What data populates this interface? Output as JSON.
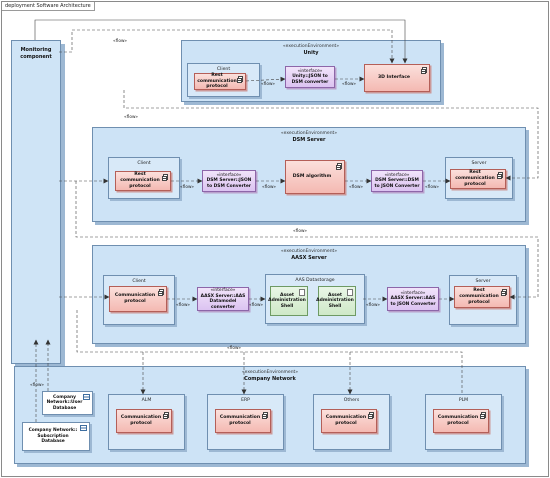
{
  "frame_title": "deployment Software Architecture",
  "monitoring": {
    "name": "Monitoring component"
  },
  "unity": {
    "stereotype": "«executionEnvironment»",
    "name": "Unity",
    "client": {
      "label": "Client",
      "component": "Rest communication protocol"
    },
    "interface": {
      "stereotype": "«interface»",
      "name": "Unity::JSON to DSM converter"
    },
    "interface3d": "3D Interface"
  },
  "dsm": {
    "stereotype": "«executionEnvironment»",
    "name": "DSM Server",
    "client": {
      "label": "Client",
      "component": "Rest communication protocol"
    },
    "iface_left": {
      "stereotype": "«interface»",
      "name": "DSM Server::JSON to DSM Converter"
    },
    "algorithm": "DSM algorithm",
    "iface_right": {
      "stereotype": "«interface»",
      "name": "DSM Server::DSM to JSON Converter"
    },
    "server": {
      "label": "Server",
      "component": "Rest communication protocol"
    }
  },
  "aasx": {
    "stereotype": "«executionEnvironment»",
    "name": "AASX Server",
    "client": {
      "label": "Client",
      "component": "Communication protocol"
    },
    "iface_left": {
      "stereotype": "«interface»",
      "name": "AASX Server::AAS Datamodel converter"
    },
    "datastorage": {
      "label": "AAS Datastorage",
      "shell1": "Asset Administration Shell",
      "shell2": "Asset Administration Shell"
    },
    "iface_right": {
      "stereotype": "«interface»",
      "name": "AASX Server::AAS to JSON Converter"
    },
    "server": {
      "label": "Server",
      "component": "Rest communication protocol"
    }
  },
  "company": {
    "stereotype": "«executionEnvironment»",
    "name": "Company Network",
    "user_db": "Company Network::User Database",
    "subscription_db": "Company Network:: Subscription Database",
    "nodes": [
      {
        "label": "ALM",
        "component": "Communication protocol"
      },
      {
        "label": "ERP",
        "component": "Communication protocol"
      },
      {
        "label": "Others",
        "component": "Communication protocol"
      },
      {
        "label": "PLM",
        "component": "Communication protocol"
      }
    ]
  },
  "flow_label": "«flow»",
  "colors": {
    "environment": "#cde3f6",
    "component": "#f4b9b2",
    "interface": "#dcc3f1",
    "artifact": "#cfe9c8",
    "border": "#6f8fb0"
  }
}
